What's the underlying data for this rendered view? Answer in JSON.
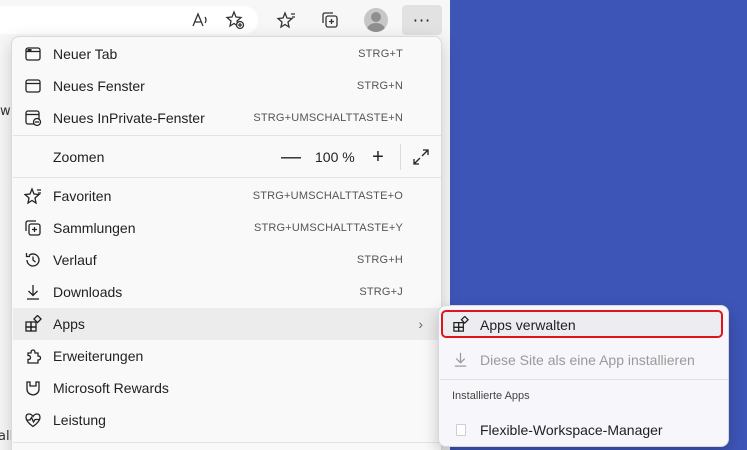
{
  "menu": {
    "items": [
      {
        "label": "Neuer Tab",
        "shortcut": "STRG+T",
        "icon": "new-tab-icon"
      },
      {
        "label": "Neues Fenster",
        "shortcut": "STRG+N",
        "icon": "new-window-icon"
      },
      {
        "label": "Neues InPrivate-Fenster",
        "shortcut": "STRG+UMSCHALTTASTE+N",
        "icon": "inprivate-icon"
      },
      {
        "label": "Zoomen",
        "zoom_value": "100 %",
        "minus": "—",
        "plus": "+",
        "icon": "expand-icon"
      },
      {
        "label": "Favoriten",
        "shortcut": "STRG+UMSCHALTTASTE+O",
        "icon": "favorites-icon"
      },
      {
        "label": "Sammlungen",
        "shortcut": "STRG+UMSCHALTTASTE+Y",
        "icon": "collections-icon"
      },
      {
        "label": "Verlauf",
        "shortcut": "STRG+H",
        "icon": "history-icon"
      },
      {
        "label": "Downloads",
        "shortcut": "STRG+J",
        "icon": "download-icon"
      },
      {
        "label": "Apps",
        "chevron": "›",
        "icon": "apps-icon"
      },
      {
        "label": "Erweiterungen",
        "icon": "extensions-icon"
      },
      {
        "label": "Microsoft Rewards",
        "icon": "rewards-icon"
      },
      {
        "label": "Leistung",
        "icon": "performance-icon"
      }
    ]
  },
  "submenu": {
    "manage_apps": "Apps verwalten",
    "install_site": "Diese Site als eine App installieren",
    "installed_header": "Installierte Apps",
    "installed_app": "Flexible-Workspace-Manager"
  },
  "toolbar": {
    "more_label": "···",
    "icons": [
      "read-aloud-icon",
      "add-favorite-icon",
      "favorites-icon",
      "collections-icon",
      "profile-icon",
      "more-icon"
    ]
  },
  "page": {
    "fragment_1": "w",
    "fragment_2": "alli"
  },
  "colors": {
    "desktop": "#3e55b8",
    "highlight_border": "#e0151b"
  }
}
